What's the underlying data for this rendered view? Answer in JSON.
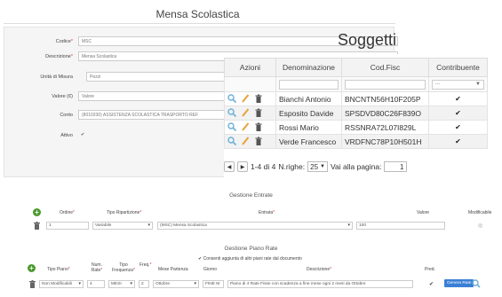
{
  "window": {
    "title": "Mensa Scolastica"
  },
  "form": {
    "fields": [
      {
        "label": "Codice",
        "required": true,
        "value": "MSC"
      },
      {
        "label": "Descrizione",
        "required": true,
        "value": "Mensa Scolastica"
      },
      {
        "label": "Unità di Misura",
        "required": false,
        "value": "Pezzi"
      },
      {
        "label": "Valore (€)",
        "required": false,
        "value": "Valore"
      },
      {
        "label": "Conto",
        "required": false,
        "value": "(8010330) ASSISTENZA SCOLASTICA TRASPORTO REF"
      }
    ],
    "attivo_label": "Attivo",
    "attivo_check": "✔"
  },
  "soggetti": {
    "title": "Soggetti",
    "columns": [
      "Azioni",
      "Denominazione",
      "Cod.Fisc",
      "Contribuente"
    ],
    "filter_select": "...",
    "rows": [
      {
        "denominazione": "Bianchi Antonio",
        "codfisc": "BNCNTN56H10F205P",
        "contribuente": "✔"
      },
      {
        "denominazione": "Esposito Davide",
        "codfisc": "SPSDVD80C26F839O",
        "contribuente": "✔"
      },
      {
        "denominazione": "Rossi Mario",
        "codfisc": "RSSNRA72L07I829L",
        "contribuente": "✔"
      },
      {
        "denominazione": "Verde Francesco",
        "codfisc": "VRDFNC78P10H501H",
        "contribuente": "✔"
      }
    ],
    "pager": {
      "range": "1-4 di 4",
      "nrighe_label": "N.righe:",
      "nrighe_value": "25",
      "vai_label": "Vai alla pagina:",
      "page": "1"
    }
  },
  "entrate": {
    "title": "Gestione Entrate",
    "headers": {
      "ordine": "Ordine",
      "tipo": "Tipo Ripartizione",
      "entrata": "Entrata",
      "valore": "Valore",
      "modificabile": "Modificabile"
    },
    "row": {
      "ordine": "1",
      "tipo": "Variabile",
      "entrata": "(MSC) Mensa Scolastica",
      "valore": "100",
      "modificabile": "◎"
    }
  },
  "rate": {
    "title": "Gestione Piano Rate",
    "note": "Consenti aggiunta di altri piani rate dal documento",
    "note_check": "✔",
    "headers": {
      "tipo": "Tipo Piano",
      "num_rate": "Num. Rate",
      "tipo_freq": "Tipo Frequenza",
      "freq": "Freq.",
      "mese": "Mese Partenza",
      "giorno": "Giorno",
      "descrizione": "Descrizione",
      "pred": "Pred."
    },
    "row": {
      "tipo": "Non Modificabili",
      "num_rate": "4",
      "tipo_freq": "MESI",
      "freq": "2",
      "mese": "Ottobre",
      "giorno": "FINE M",
      "descrizione": "Piano di 4 Rate Fisse con scadenza a fine mese ogni 2 mesi da Ottobre",
      "pred": "✔",
      "button": "Genera Rate"
    }
  },
  "colors": {
    "accent": "#3a7fd5",
    "plus": "#4a9a2e",
    "pencil": "#e8a23a",
    "search": "#6bb0d8",
    "required": "#dd3333"
  }
}
